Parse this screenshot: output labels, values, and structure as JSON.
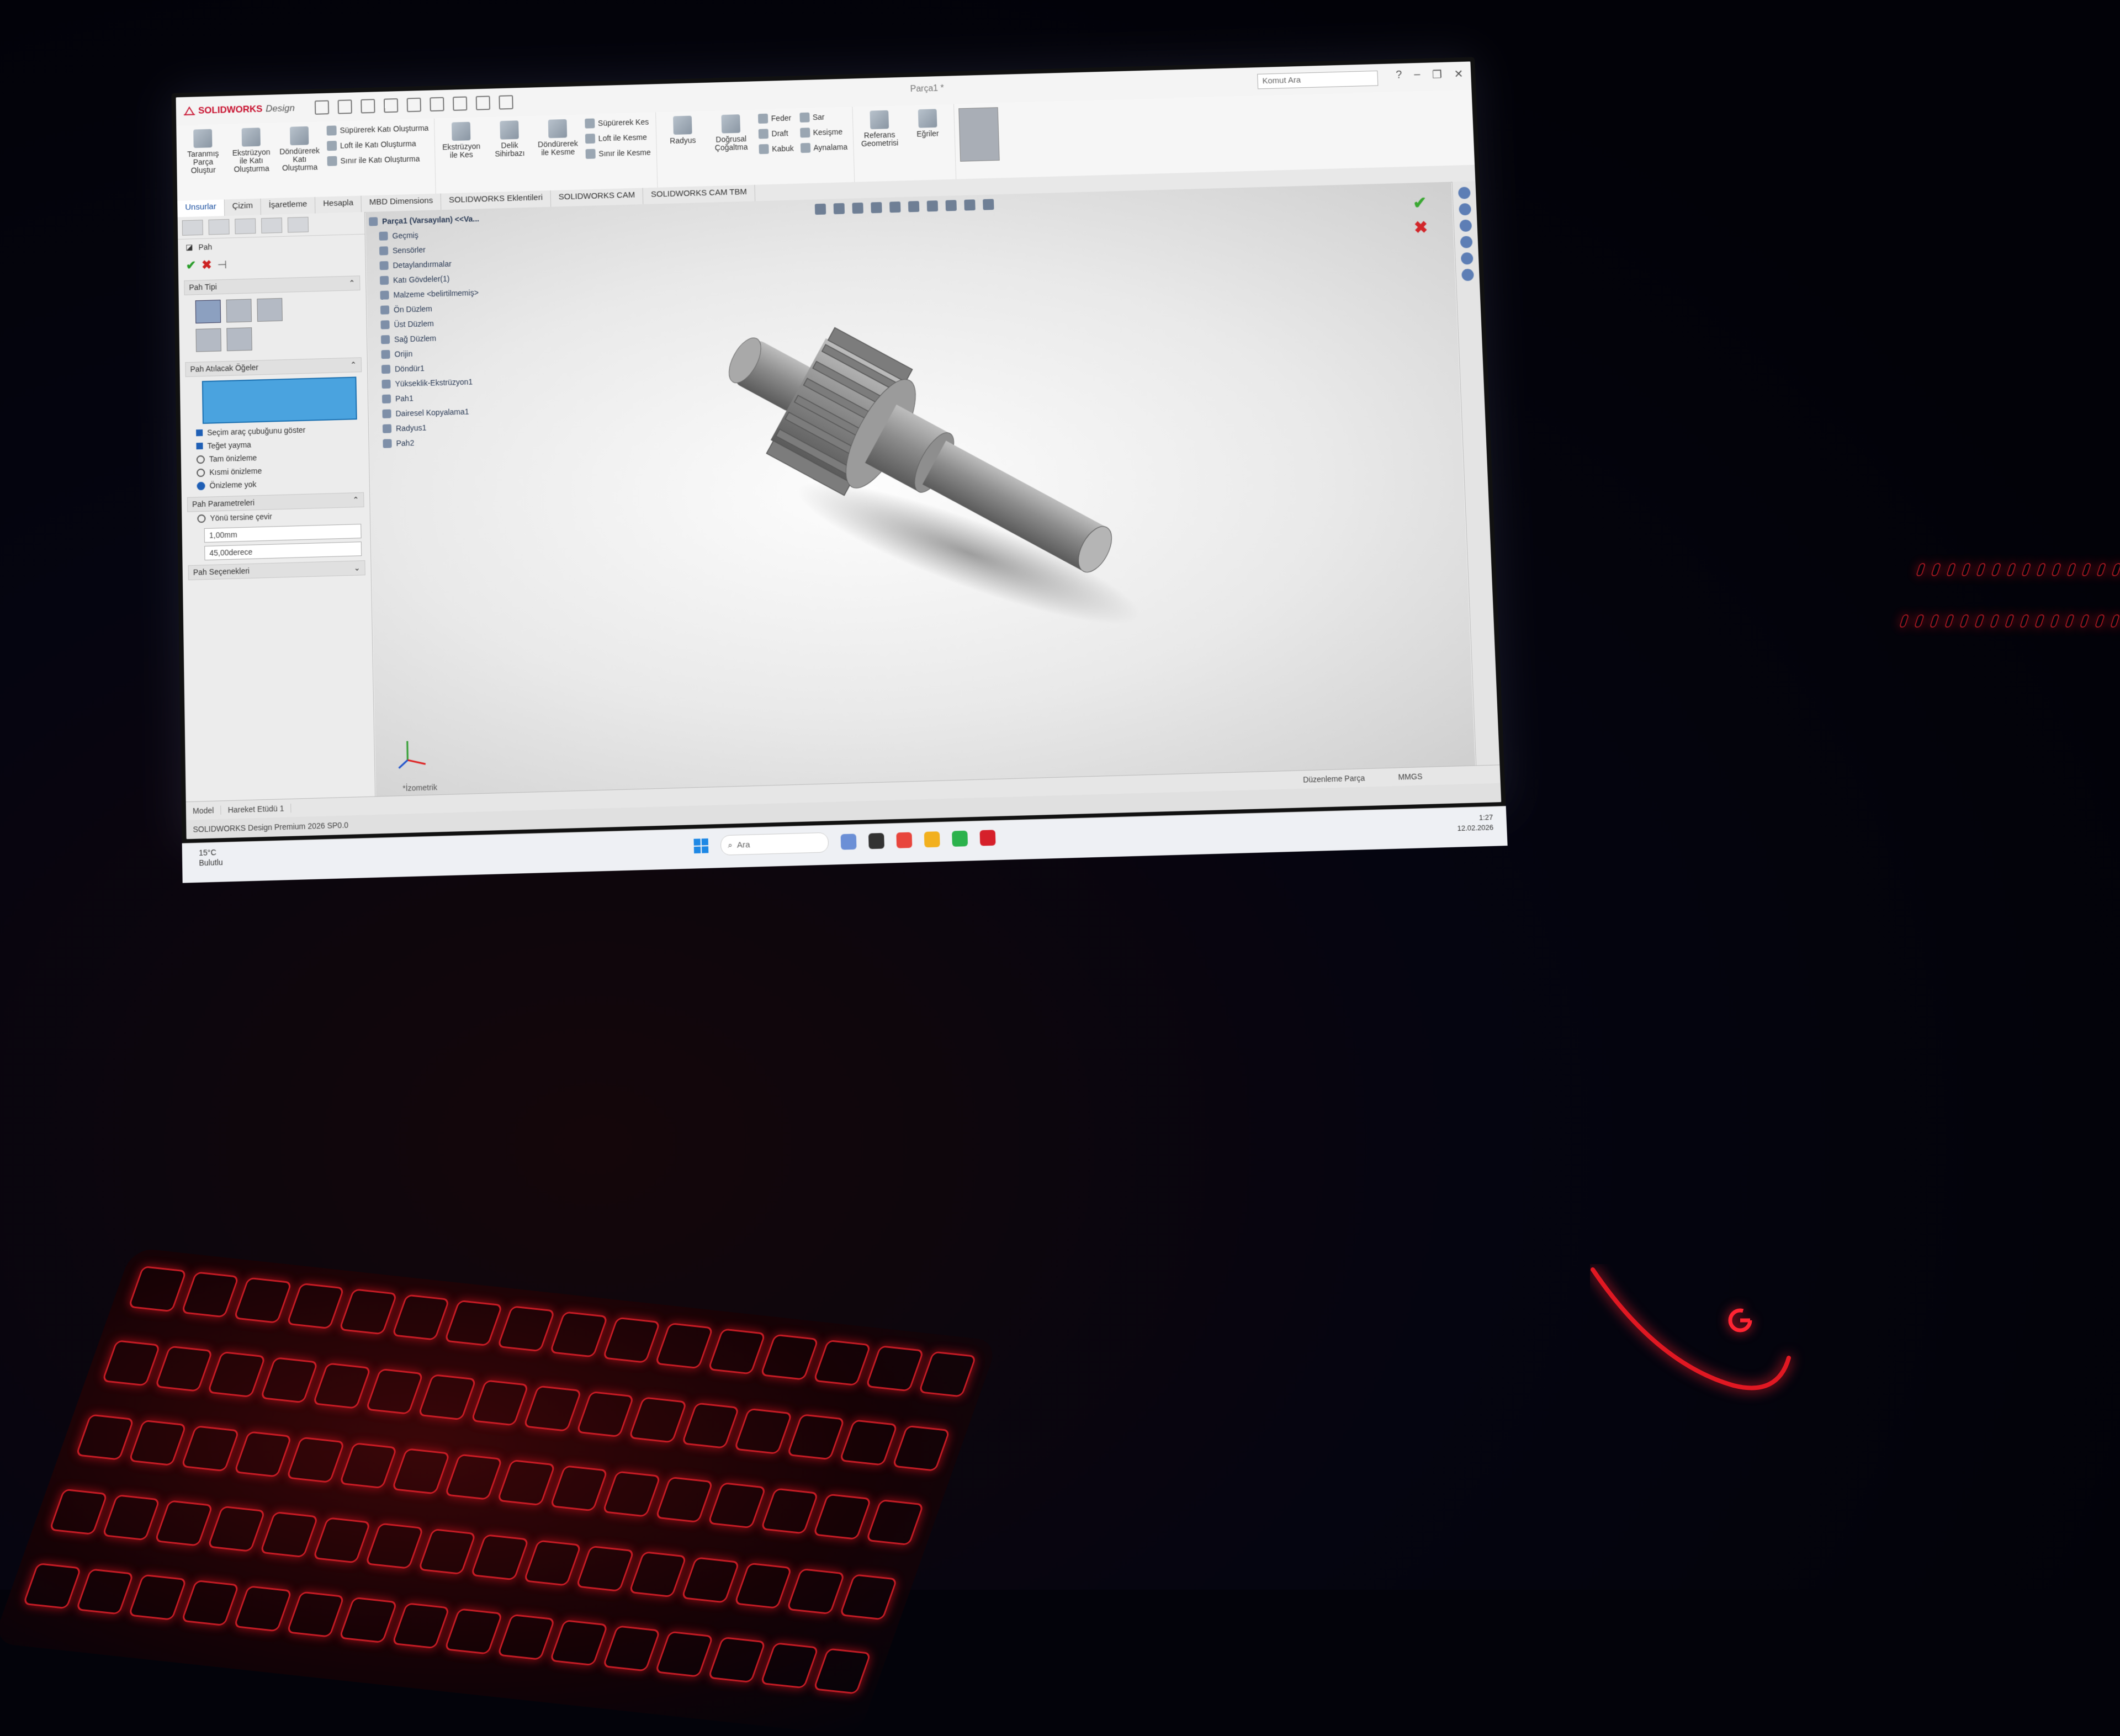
{
  "app": {
    "brand": "SOLIDWORKS",
    "edition": "Design",
    "doc_title": "Parça1 *",
    "search_placeholder": "Komut Ara",
    "ribbon": {
      "big_buttons": [
        "Taranmış Parça Oluştur",
        "Ekstrüzyon ile Katı Oluşturma",
        "Döndürerek Katı Oluşturma"
      ],
      "feature_col1": [
        "Süpürerek Katı Oluşturma",
        "Loft ile Katı Oluşturma",
        "Sınır ile Katı Oluşturma"
      ],
      "cut_buttons": [
        "Ekstrüzyon ile Kes",
        "Delik Sihirbazı",
        "Döndürerek ile Kesme"
      ],
      "cut_col": [
        "Süpürerek Kes",
        "Loft ile Kesme",
        "Sınır ile Kesme"
      ],
      "pattern_buttons": [
        "Radyus",
        "Doğrusal Çoğaltma"
      ],
      "pattern_col1": [
        "Feder",
        "Draft",
        "Kabuk"
      ],
      "pattern_col2": [
        "Sar",
        "Kesişme",
        "Aynalama"
      ],
      "ref_buttons": [
        "Referans Geometrisi",
        "Eğriler"
      ]
    },
    "tabs": [
      "Unsurlar",
      "Çizim",
      "İşaretleme",
      "Hesapla",
      "MBD Dimensions",
      "SOLIDWORKS Eklentileri",
      "SOLIDWORKS CAM",
      "SOLIDWORKS CAM TBM"
    ],
    "active_tab": "Unsurlar"
  },
  "property_manager": {
    "title": "Pah",
    "type_section": "Pah Tipi",
    "selection_section": "Pah Atılacak Öğeler",
    "option_checkbox_1": "Seçim araç çubuğunu göster",
    "option_checkbox_2": "Teğet yayma",
    "radio_1": "Tam önizleme",
    "radio_2": "Kısmi önizleme",
    "radio_3": "Önizleme yok",
    "params_section": "Pah Parametreleri",
    "flip_direction": "Yönü tersine çevir",
    "distance_value": "1,00mm",
    "angle_value": "45,00derece",
    "options_section": "Pah Seçenekleri"
  },
  "feature_tree": {
    "root": "Parça1 (Varsayılan) <<Va...",
    "items": [
      "Geçmiş",
      "Sensörler",
      "Detaylandırmalar",
      "Katı Gövdeler(1)",
      "Malzeme <belirtilmemiş>",
      "Ön Düzlem",
      "Üst Düzlem",
      "Sağ Düzlem",
      "Orijin",
      "Döndür1",
      "Yükseklik-Ekstrüzyon1",
      "Pah1",
      "Dairesel Kopyalama1",
      "Radyus1",
      "Pah2"
    ]
  },
  "viewport": {
    "view_label": "*İzometrik",
    "model_name": "gear-shaft"
  },
  "status": {
    "tabs": [
      "Model",
      "Hareket Etüdü 1"
    ],
    "footer": "SOLIDWORKS Design Premium 2026 SP0.0",
    "mode": "Düzenleme Parça",
    "units": "MMGS"
  },
  "taskbar": {
    "weather_temp": "15°C",
    "weather_desc": "Bulutlu",
    "search": "Ara",
    "time": "1:27",
    "date": "12.02.2026"
  },
  "colors": {
    "brand_red": "#c8102e",
    "accent_blue": "#1f5fb5",
    "keyboard_glow": "#e0202a"
  }
}
